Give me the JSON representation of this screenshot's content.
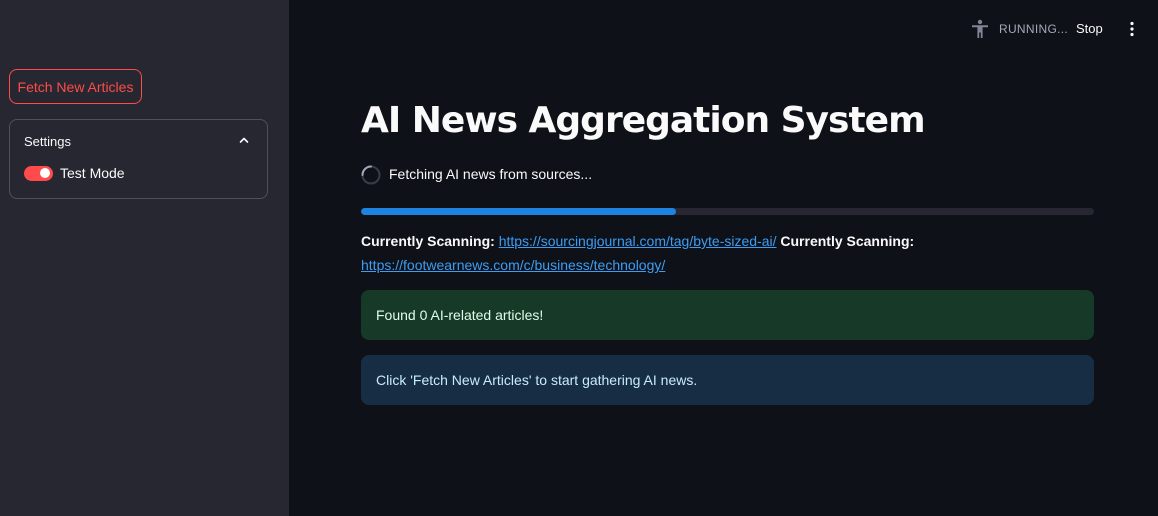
{
  "sidebar": {
    "fetch_button": "Fetch New Articles",
    "settings": {
      "title": "Settings",
      "expanded": true,
      "test_mode": {
        "label": "Test Mode",
        "enabled": true
      }
    }
  },
  "toolbar": {
    "status": "RUNNING...",
    "stop_label": "Stop",
    "icons": [
      "accessibility-person-icon",
      "more-vert-icon"
    ]
  },
  "main": {
    "title": "AI News Aggregation System",
    "spinner_text": "Fetching AI news from sources...",
    "progress": 0.43,
    "scan": {
      "label1": "Currently Scanning:",
      "url1": "https://sourcingjournal.com/tag/byte-sized-ai/",
      "label2": "Currently Scanning:",
      "url2": "https://footwearnews.com/c/business/technology/"
    },
    "success_message": "Found 0 AI-related articles!",
    "info_message": "Click 'Fetch New Articles' to start gathering AI news."
  },
  "colors": {
    "background": "#0e1117",
    "sidebar": "#262730",
    "accent": "#ff4b4b",
    "progress": "#1c83e1",
    "link": "#3d9df3",
    "success_bg": "#173928",
    "info_bg": "#172d43"
  }
}
